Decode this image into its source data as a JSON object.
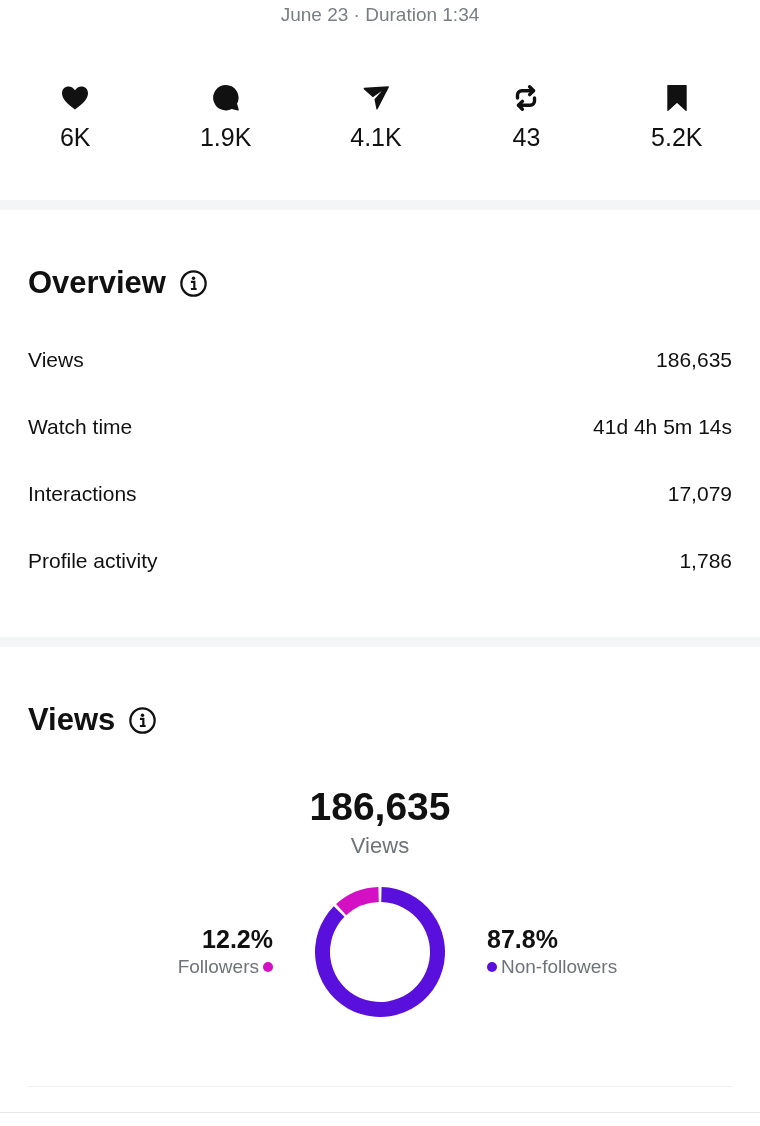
{
  "header": {
    "meta": "June 23 · Duration 1:34"
  },
  "stats": [
    {
      "kind": "likes",
      "value": "6K"
    },
    {
      "kind": "comments",
      "value": "1.9K"
    },
    {
      "kind": "shares",
      "value": "4.1K"
    },
    {
      "kind": "reposts",
      "value": "43"
    },
    {
      "kind": "saves",
      "value": "5.2K"
    }
  ],
  "overview": {
    "title": "Overview",
    "rows": [
      {
        "label": "Views",
        "value": "186,635"
      },
      {
        "label": "Watch time",
        "value": "41d 4h 5m 14s"
      },
      {
        "label": "Interactions",
        "value": "17,079"
      },
      {
        "label": "Profile activity",
        "value": "1,786"
      }
    ]
  },
  "views": {
    "title": "Views",
    "total": "186,635",
    "total_label": "Views",
    "legend": [
      {
        "percent": "12.2%",
        "color": "#d410c4"
      },
      {
        "percent": "87.8%",
        "color": "#5a10dc"
      }
    ],
    "chart_data": {
      "type": "donut",
      "categories": [
        "Followers",
        "Non-followers"
      ],
      "values": [
        12.2,
        87.8
      ]
    }
  }
}
